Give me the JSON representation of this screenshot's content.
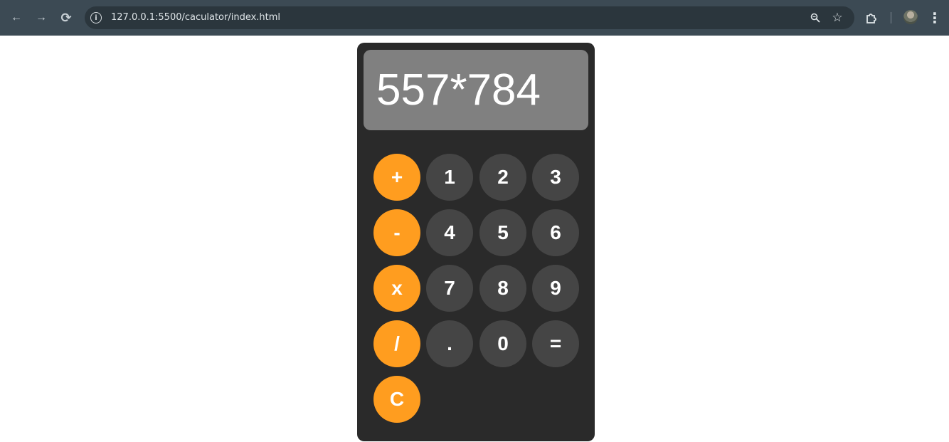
{
  "browser": {
    "url": "127.0.0.1:5500/caculator/index.html",
    "back_icon": "←",
    "forward_icon": "→",
    "reload_icon": "⟳",
    "info_icon": "i",
    "zoom_icon": "⌕",
    "star_icon": "☆",
    "menu_icon": "⋮"
  },
  "calculator": {
    "display": "557*784",
    "keys": {
      "plus": "+",
      "one": "1",
      "two": "2",
      "three": "3",
      "minus": "-",
      "four": "4",
      "five": "5",
      "six": "6",
      "multiply": "x",
      "seven": "7",
      "eight": "8",
      "nine": "9",
      "divide": "/",
      "dot": ".",
      "zero": "0",
      "equals": "=",
      "clear": "C"
    },
    "colors": {
      "operator": "#ff9d1f",
      "number": "#454545",
      "body": "#2a2a2a",
      "display": "#808080"
    }
  }
}
